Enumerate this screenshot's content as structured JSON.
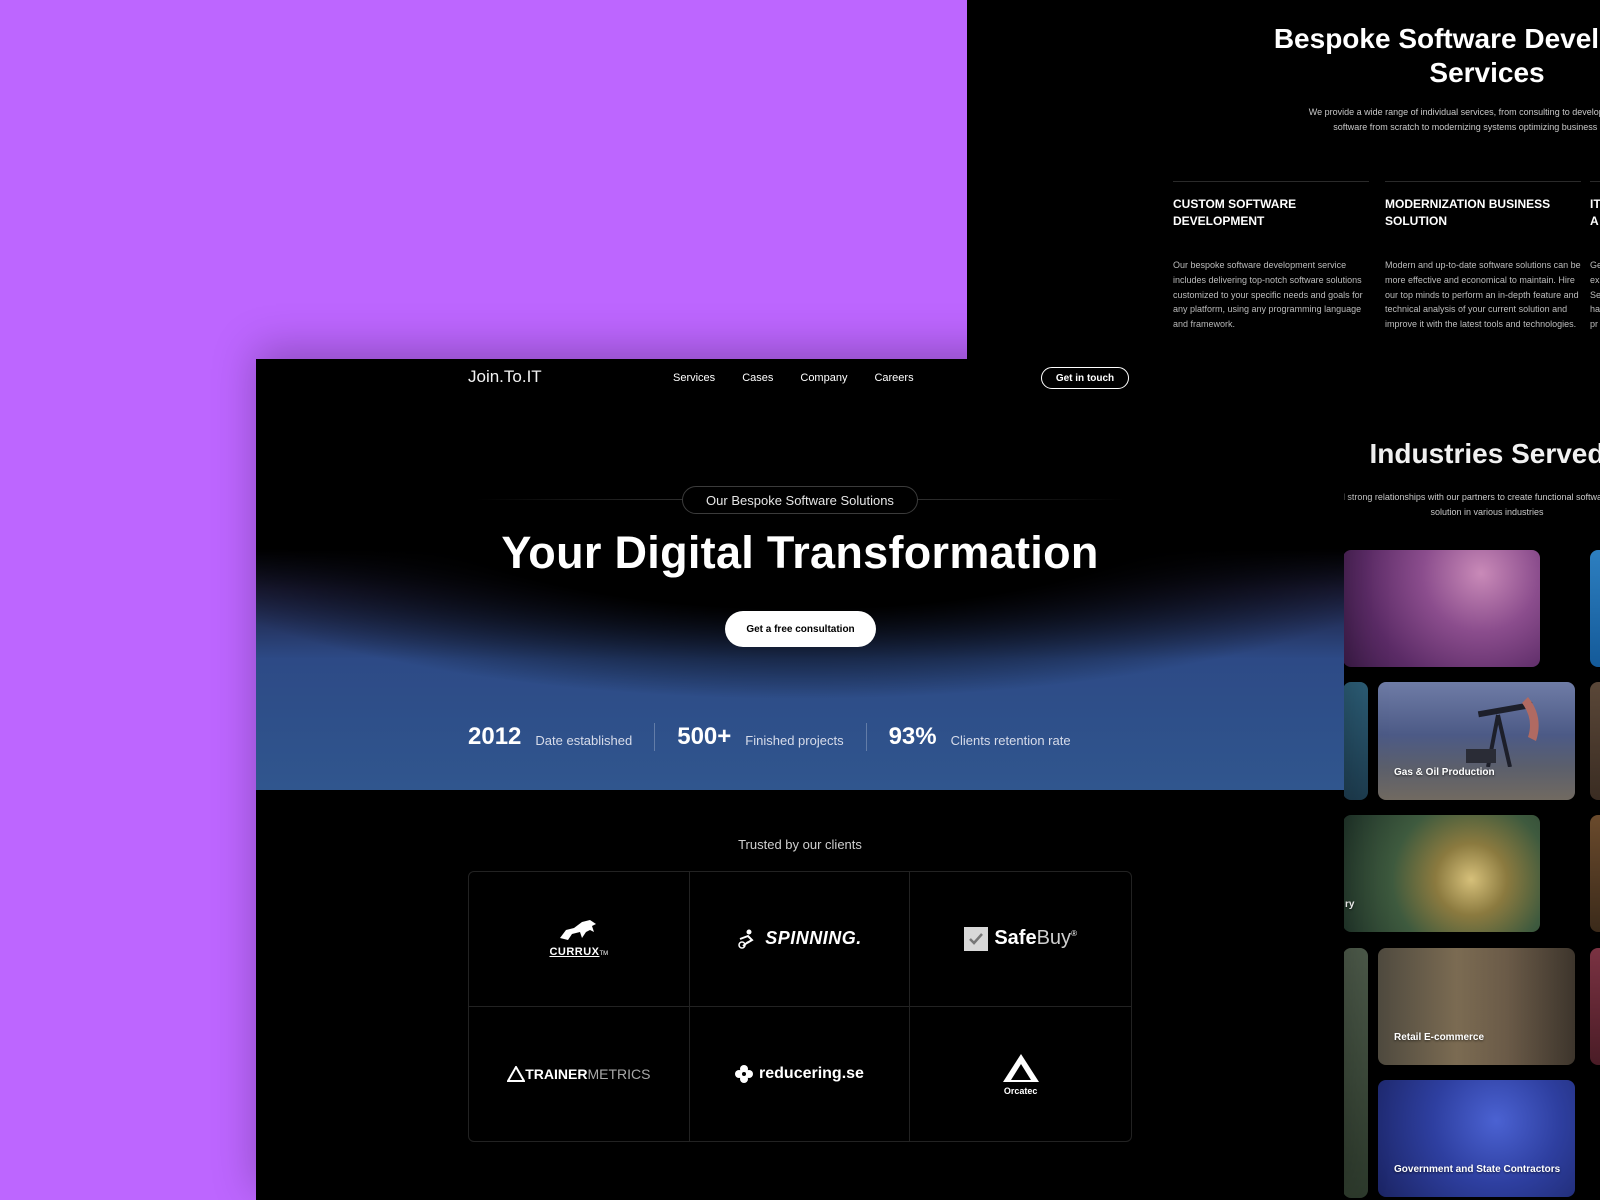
{
  "back_page": {
    "title": "Bespoke Software Development Services",
    "subtitle": "We provide a wide range of individual services, from consulting to development of custom software from scratch to modernizing systems optimizing business processes",
    "services": [
      {
        "title": "Custom Software Development",
        "text": "Our bespoke software development service includes delivering top-notch software solutions customized to your specific needs and goals for any platform, using any programming language and framework."
      },
      {
        "title": "Modernization Business Solution",
        "text": "Modern and up-to-date software solutions can be more effective and economical to maintain. Hire our top minds to perform an in-depth feature and technical analysis of your current solution and improve it with the latest tools and technologies."
      },
      {
        "title": "IT A",
        "text": "Ge ex m Se ha m pr"
      }
    ],
    "industries": {
      "title": "Industries Served",
      "subtitle": "We build strong relationships with our partners to create functional software development solution in various industries",
      "tiles": [
        {
          "label": ""
        },
        {
          "label": "Gas & Oil Production"
        },
        {
          "label": "ry"
        },
        {
          "label": "Retail E-commerce"
        },
        {
          "label": "Government and State Contractors"
        }
      ]
    }
  },
  "front_page": {
    "nav": {
      "logo": "Join.To.IT",
      "links": [
        "Services",
        "Cases",
        "Company",
        "Careers"
      ],
      "cta": "Get in touch"
    },
    "hero": {
      "pill": "Our Bespoke Software Solutions",
      "title": "Your Digital Transformation",
      "cta": "Get a free consultation"
    },
    "stats": [
      {
        "value": "2012",
        "label": "Date established"
      },
      {
        "value": "500+",
        "label": "Finished projects"
      },
      {
        "value": "93%",
        "label": "Clients retention rate"
      }
    ],
    "clients": {
      "heading": "Trusted by our clients",
      "logos": [
        {
          "name": "currux",
          "text": "CURRUX",
          "mark": "TM"
        },
        {
          "name": "spinning",
          "text": "SPINNING."
        },
        {
          "name": "safebuy",
          "text_a": "Safe",
          "text_b": "Buy",
          "mark": "®"
        },
        {
          "name": "trainermetrics",
          "text_a": "TRAINER",
          "text_b": "METRICS"
        },
        {
          "name": "reducering",
          "text": "reducering.se"
        },
        {
          "name": "orcatec",
          "text": "Orcatec"
        }
      ]
    }
  },
  "colors": {
    "canvas": "#bd66ff",
    "page": "#000000",
    "hero_gradient": "#30568e"
  }
}
